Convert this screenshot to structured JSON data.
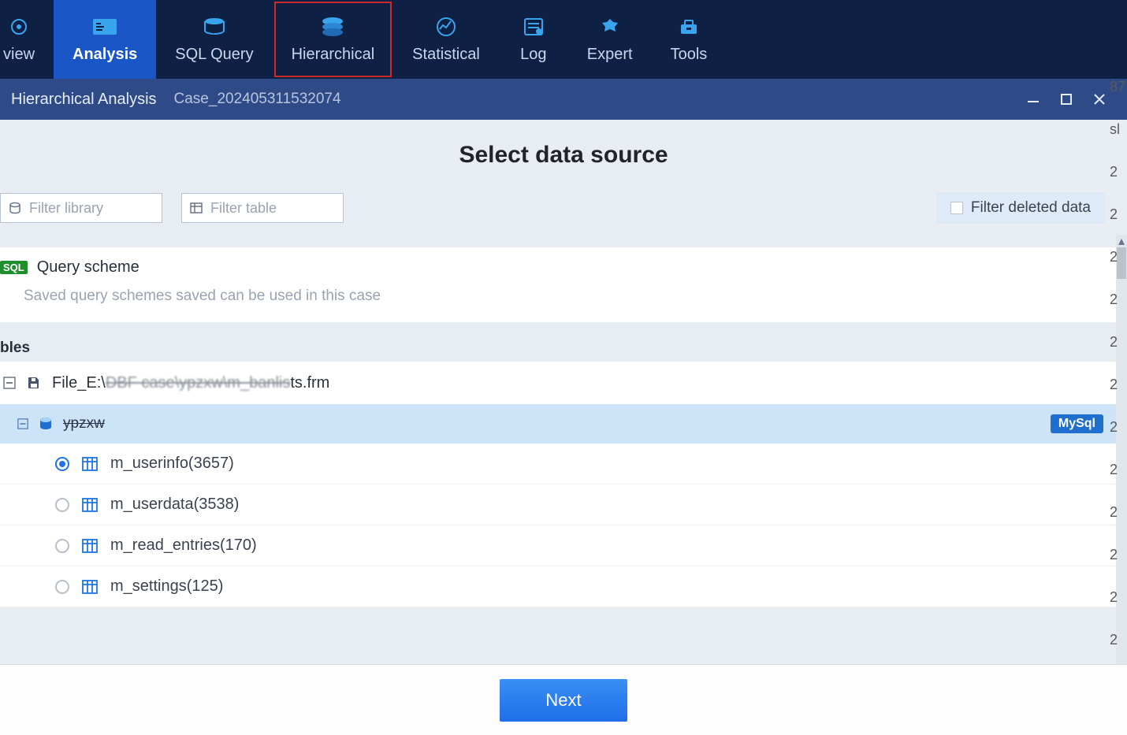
{
  "ribbon": {
    "items": [
      {
        "label": "view"
      },
      {
        "label": "Analysis"
      },
      {
        "label": "SQL Query"
      },
      {
        "label": "Hierarchical"
      },
      {
        "label": "Statistical"
      },
      {
        "label": "Log"
      },
      {
        "label": "Expert"
      },
      {
        "label": "Tools"
      }
    ]
  },
  "titlebar": {
    "title": "Hierarchical Analysis",
    "case": "Case_202405311532074"
  },
  "heading": "Select data source",
  "filters": {
    "library_placeholder": "Filter library",
    "table_placeholder": "Filter table",
    "deleted_label": "Filter deleted data"
  },
  "query_scheme": {
    "badge": "SQL",
    "title": "Query scheme",
    "hint": "Saved query schemes saved can be used in this case"
  },
  "section_tables_label": "bles",
  "file": {
    "prefix": "File_E:\\",
    "strike": "DBF case\\ypzxw\\m_banlis",
    "suffix": "ts.frm"
  },
  "database": {
    "name": "ypzxw",
    "engine": "MySql"
  },
  "tables": [
    {
      "name": "m_userinfo(3657)",
      "selected": true
    },
    {
      "name": "m_userdata(3538)",
      "selected": false
    },
    {
      "name": "m_read_entries(170)",
      "selected": false
    },
    {
      "name": "m_settings(125)",
      "selected": false
    }
  ],
  "footer": {
    "next": "Next"
  },
  "bg_numbers": [
    "87",
    "sl",
    "2",
    "2",
    "2",
    "2",
    "2",
    "2",
    "2",
    "2",
    "2",
    "2",
    "2",
    "2"
  ]
}
